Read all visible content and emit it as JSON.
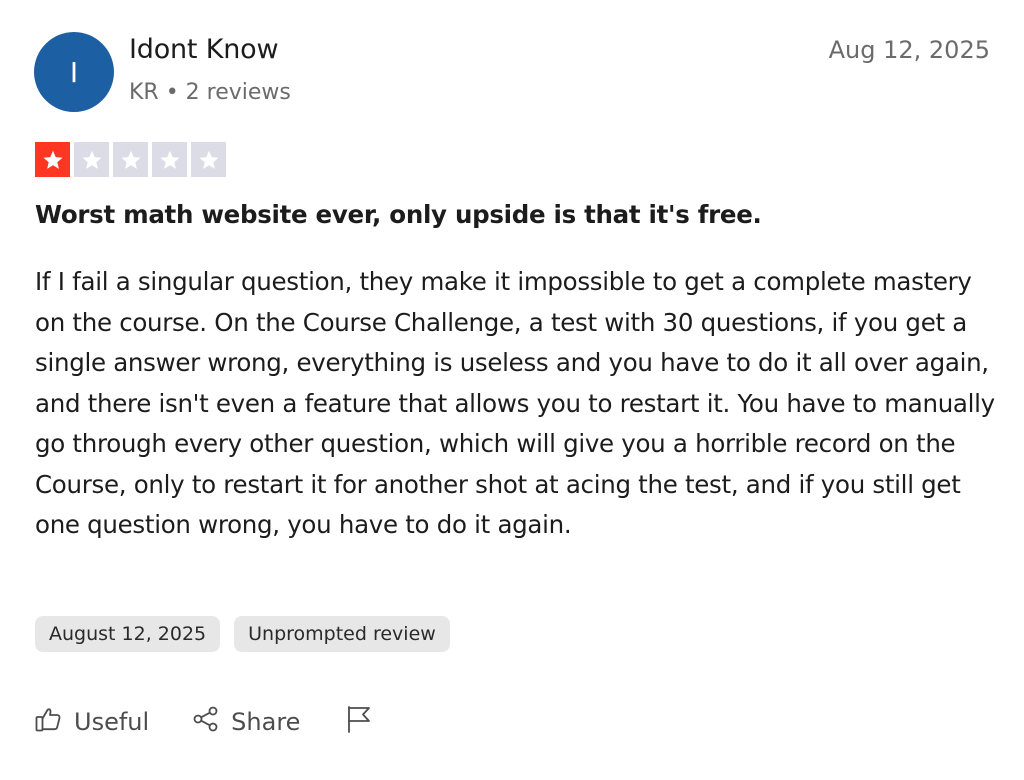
{
  "reviewer": {
    "initial": "I",
    "name": "Idont Know",
    "meta": "KR • 2 reviews",
    "avatar_color": "#1d5fa3"
  },
  "review": {
    "date": "Aug 12, 2025",
    "rating": 1,
    "rating_max": 5,
    "star_filled_color": "#ff3722",
    "star_empty_color": "#dcdce6",
    "title": "Worst math website ever, only upside is that it's free.",
    "body": "If I fail a singular question, they make it impossible to get a complete mastery on the course. On the Course Challenge, a test with 30 questions, if you get a single answer wrong, everything is useless and you have to do it all over again, and there isn't even a feature that allows you to restart it. You have to manually go through every other question, which will give you a horrible record on the Course, only to restart it for another shot at acing the test, and if you still get one question wrong, you have to do it again."
  },
  "tags": {
    "date_of_experience": "August 12, 2025",
    "review_type": "Unprompted review"
  },
  "actions": {
    "useful_label": "Useful",
    "useful_icon": "thumbs-up-icon",
    "share_label": "Share",
    "share_icon": "share-icon",
    "report_icon": "flag-icon"
  }
}
